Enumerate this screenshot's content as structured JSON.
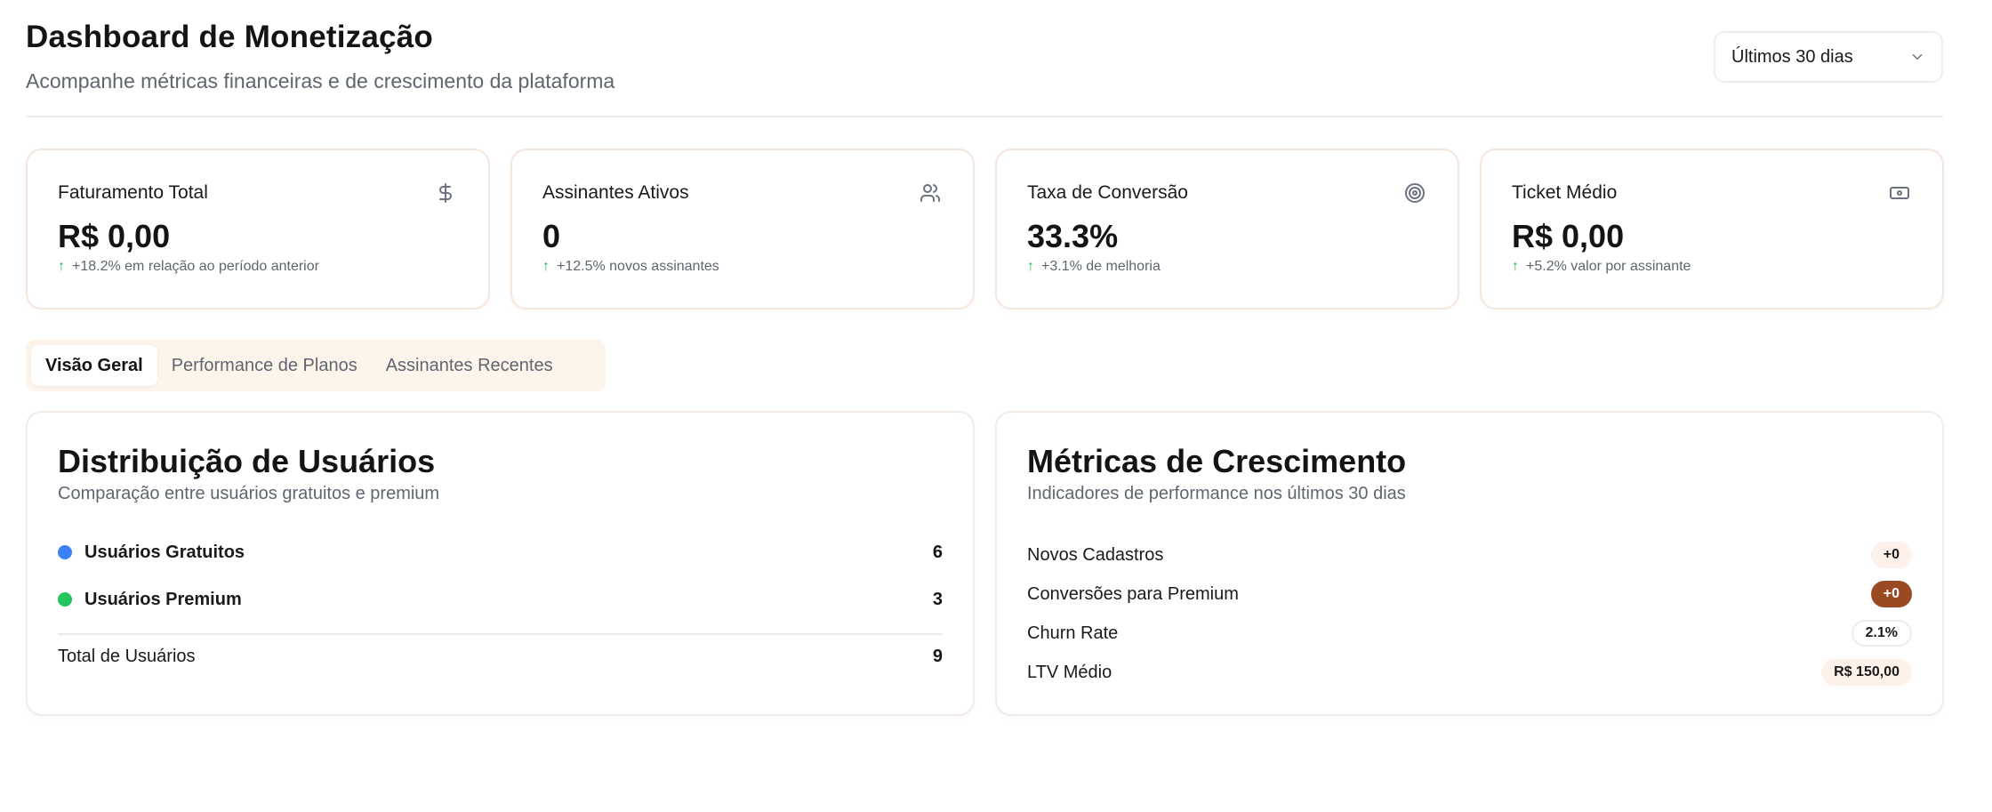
{
  "header": {
    "title": "Dashboard de Monetização",
    "subtitle": "Acompanhe métricas financeiras e de crescimento da plataforma",
    "range_select": {
      "value": "Últimos 30 dias",
      "icon": "chevron-down-icon"
    }
  },
  "kpis": [
    {
      "label": "Faturamento Total",
      "value": "R$ 0,00",
      "note": "+18.2% em relação ao período anterior",
      "icon": "dollar-icon"
    },
    {
      "label": "Assinantes Ativos",
      "value": "0",
      "note": "+12.5% novos assinantes",
      "icon": "users-icon"
    },
    {
      "label": "Taxa de Conversão",
      "value": "33.3%",
      "note": "+3.1% de melhoria",
      "icon": "target-icon"
    },
    {
      "label": "Ticket Médio",
      "value": "R$ 0,00",
      "note": "+5.2% valor por assinante",
      "icon": "banknote-icon"
    }
  ],
  "trend_arrow": "↑",
  "tabs": [
    {
      "label": "Visão Geral",
      "active": true
    },
    {
      "label": "Performance de Planos",
      "active": false
    },
    {
      "label": "Assinantes Recentes",
      "active": false
    }
  ],
  "distribution": {
    "title": "Distribuição de Usuários",
    "subtitle": "Comparação entre usuários gratuitos e premium",
    "rows": [
      {
        "label": "Usuários Gratuitos",
        "value": "6",
        "color": "#3b82f6"
      },
      {
        "label": "Usuários Premium",
        "value": "3",
        "color": "#22c55e"
      }
    ],
    "total_label": "Total de Usuários",
    "total_value": "9"
  },
  "growth": {
    "title": "Métricas de Crescimento",
    "subtitle": "Indicadores de performance nos últimos 30 dias",
    "rows": [
      {
        "label": "Novos Cadastros",
        "value": "+0",
        "badge_style": "light"
      },
      {
        "label": "Conversões para Premium",
        "value": "+0",
        "badge_style": "brown"
      },
      {
        "label": "Churn Rate",
        "value": "2.1%",
        "badge_style": "outline"
      },
      {
        "label": "LTV Médio",
        "value": "R$ 150,00",
        "badge_style": "light"
      }
    ]
  },
  "colors": {
    "accent_brown": "#9a4a22",
    "tab_bg": "#fdf4ec",
    "positive": "#22b35b",
    "card_border": "#f5e6dd"
  }
}
